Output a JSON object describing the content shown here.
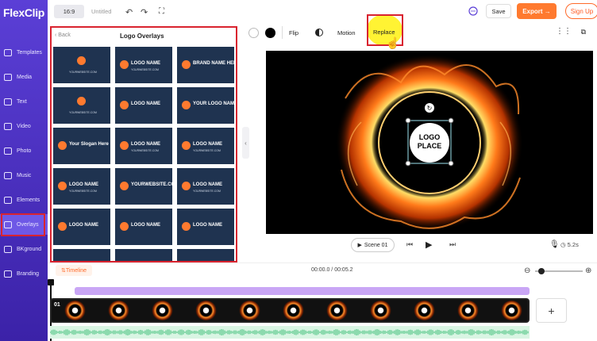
{
  "app": {
    "logo_text": "FlexClip"
  },
  "sidebar": {
    "items": [
      {
        "label": "Templates"
      },
      {
        "label": "Media"
      },
      {
        "label": "Text"
      },
      {
        "label": "Video"
      },
      {
        "label": "Photo"
      },
      {
        "label": "Music"
      },
      {
        "label": "Elements"
      },
      {
        "label": "Overlays"
      },
      {
        "label": "BKground"
      },
      {
        "label": "Branding"
      }
    ]
  },
  "topbar": {
    "ratio": "16:9",
    "title": "Untitled",
    "save_label": "Save",
    "export_label": "Export →",
    "signup_label": "Sign Up"
  },
  "panel": {
    "back_label": "Back",
    "title": "Logo Overlays",
    "thumbs": [
      {
        "main": "",
        "sub": "YOURWEBSITE.COM"
      },
      {
        "main": "LOGO NAME",
        "sub": "YOURWEBSITE.COM"
      },
      {
        "main": "BRAND NAME HERE",
        "sub": ""
      },
      {
        "main": "",
        "sub": "YOURWEBSITE.COM"
      },
      {
        "main": "LOGO  NAME",
        "sub": ""
      },
      {
        "main": "YOUR LOGO NAME",
        "sub": ""
      },
      {
        "main": "Your Slogan Here",
        "sub": ""
      },
      {
        "main": "LOGO NAME",
        "sub": "YOURWEBSITE.COM"
      },
      {
        "main": "LOGO NAME",
        "sub": "YOURWEBSITE.COM"
      },
      {
        "main": "LOGO NAME",
        "sub": "YOURWEBSITE.COM"
      },
      {
        "main": "YOURWEBSITE.COM",
        "sub": ""
      },
      {
        "main": "LOGO NAME",
        "sub": "YOURWEBSITE.COM"
      },
      {
        "main": "LOGO NAME",
        "sub": ""
      },
      {
        "main": "LOGO NAME",
        "sub": ""
      },
      {
        "main": "LOGO NAME",
        "sub": ""
      },
      {
        "main": "",
        "sub": ""
      },
      {
        "main": "",
        "sub": ""
      },
      {
        "main": "",
        "sub": ""
      }
    ]
  },
  "editbar": {
    "flip_label": "Flip",
    "motion_label": "Motion",
    "replace_label": "Replace"
  },
  "canvas": {
    "logo_line1": "LOGO",
    "logo_line2": "PLACE"
  },
  "player": {
    "scene_label": "Scene 01",
    "time_current": "00:00.0",
    "time_sep": " / ",
    "time_total": "00:05.2",
    "duration": "5.2s"
  },
  "timeline": {
    "label": "Timeline",
    "clip_index": "01",
    "add_label": "+"
  },
  "colors": {
    "accent": "#ff7a2f",
    "sidebar": "#4a2fc4",
    "highlight": "#d9232f"
  }
}
